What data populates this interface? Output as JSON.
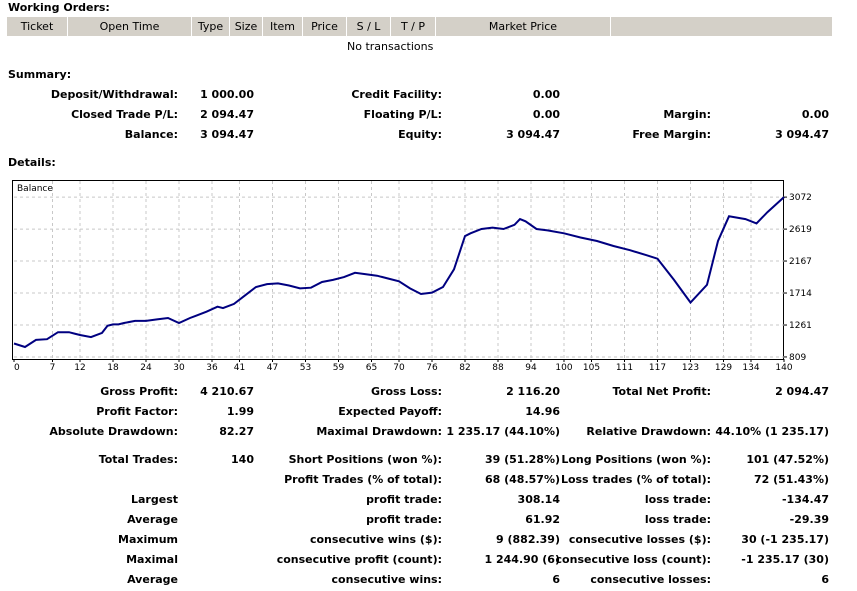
{
  "working_orders": {
    "title": "Working Orders:",
    "columns": [
      "Ticket",
      "Open Time",
      "Type",
      "Size",
      "Item",
      "Price",
      "S / L",
      "T / P",
      "Market Price"
    ],
    "empty_text": "No transactions"
  },
  "summary": {
    "title": "Summary:",
    "deposit_label": "Deposit/Withdrawal:",
    "deposit_value": "1 000.00",
    "credit_label": "Credit Facility:",
    "credit_value": "0.00",
    "closed_label": "Closed Trade P/L:",
    "closed_value": "2 094.47",
    "floating_label": "Floating P/L:",
    "floating_value": "0.00",
    "margin_label": "Margin:",
    "margin_value": "0.00",
    "balance_label": "Balance:",
    "balance_value": "3 094.47",
    "equity_label": "Equity:",
    "equity_value": "3 094.47",
    "free_margin_label": "Free Margin:",
    "free_margin_value": "3 094.47"
  },
  "details": {
    "title": "Details:"
  },
  "chart_data": {
    "type": "line",
    "title": "Balance",
    "xlabel": "",
    "ylabel": "",
    "x_ticks": [
      0,
      7,
      12,
      18,
      24,
      30,
      36,
      41,
      47,
      53,
      59,
      65,
      70,
      76,
      82,
      88,
      94,
      100,
      105,
      111,
      117,
      123,
      129,
      134,
      140
    ],
    "y_ticks": [
      809,
      1261,
      1714,
      2167,
      2619,
      3072
    ],
    "xlim": [
      0,
      140
    ],
    "ylim": [
      780,
      3300
    ],
    "grid": true,
    "series": [
      {
        "name": "",
        "color": "#000080",
        "x": [
          0,
          2,
          4,
          6,
          8,
          10,
          11,
          12,
          14,
          16,
          17,
          18,
          19,
          20,
          22,
          24,
          26,
          28,
          30,
          32,
          33,
          35,
          37,
          38,
          40,
          42,
          44,
          46,
          48,
          50,
          52,
          54,
          56,
          58,
          60,
          62,
          64,
          66,
          68,
          70,
          72,
          74,
          76,
          78,
          80,
          82,
          83,
          85,
          87,
          89,
          91,
          92,
          93,
          95,
          97,
          100,
          103,
          106,
          109,
          112,
          115,
          117,
          120,
          123,
          126,
          128,
          130,
          133,
          135,
          137,
          140
        ],
        "y": [
          1000,
          950,
          1050,
          1060,
          1160,
          1160,
          1140,
          1120,
          1090,
          1150,
          1250,
          1270,
          1270,
          1290,
          1320,
          1320,
          1340,
          1360,
          1290,
          1360,
          1390,
          1450,
          1520,
          1500,
          1560,
          1680,
          1800,
          1840,
          1850,
          1820,
          1780,
          1790,
          1870,
          1900,
          1940,
          2000,
          1980,
          1960,
          1920,
          1880,
          1780,
          1700,
          1720,
          1800,
          2050,
          2520,
          2560,
          2620,
          2640,
          2620,
          2680,
          2760,
          2730,
          2620,
          2600,
          2560,
          2500,
          2450,
          2380,
          2320,
          2250,
          2200,
          1900,
          1580,
          1830,
          2450,
          2800,
          2760,
          2700,
          2860,
          3072
        ]
      }
    ]
  },
  "stats": {
    "gross_profit_label": "Gross Profit:",
    "gross_profit_value": "4 210.67",
    "gross_loss_label": "Gross Loss:",
    "gross_loss_value": "2 116.20",
    "total_net_label": "Total Net Profit:",
    "total_net_value": "2 094.47",
    "profit_factor_label": "Profit Factor:",
    "profit_factor_value": "1.99",
    "expected_payoff_label": "Expected Payoff:",
    "expected_payoff_value": "14.96",
    "abs_dd_label": "Absolute Drawdown:",
    "abs_dd_value": "82.27",
    "max_dd_label": "Maximal Drawdown:",
    "max_dd_value": "1 235.17 (44.10%)",
    "rel_dd_label": "Relative Drawdown:",
    "rel_dd_value": "44.10% (1 235.17)",
    "total_trades_label": "Total Trades:",
    "total_trades_value": "140",
    "short_label": "Short Positions (won %):",
    "short_value": "39 (51.28%)",
    "long_label": "Long Positions (won %):",
    "long_value": "101 (47.52%)",
    "profit_trades_label": "Profit Trades (% of total):",
    "profit_trades_value": "68 (48.57%)",
    "loss_trades_label": "Loss trades (% of total):",
    "loss_trades_value": "72 (51.43%)",
    "largest_label": "Largest",
    "largest_profit_label": "profit trade:",
    "largest_profit_value": "308.14",
    "largest_loss_label": "loss trade:",
    "largest_loss_value": "-134.47",
    "average_label": "Average",
    "average_profit_label": "profit trade:",
    "average_profit_value": "61.92",
    "average_loss_label": "loss trade:",
    "average_loss_value": "-29.39",
    "maximum_label": "Maximum",
    "max_cons_wins_label": "consecutive wins ($):",
    "max_cons_wins_value": "9 (882.39)",
    "max_cons_losses_label": "consecutive losses ($):",
    "max_cons_losses_value": "30 (-1 235.17)",
    "maximal_label": "Maximal",
    "maximal_cons_profit_label": "consecutive profit (count):",
    "maximal_cons_profit_value": "1 244.90 (6)",
    "maximal_cons_loss_label": "consecutive loss (count):",
    "maximal_cons_loss_value": "-1 235.17 (30)",
    "average2_label": "Average",
    "avg_cons_wins_label": "consecutive wins:",
    "avg_cons_wins_value": "6",
    "avg_cons_losses_label": "consecutive losses:",
    "avg_cons_losses_value": "6"
  }
}
